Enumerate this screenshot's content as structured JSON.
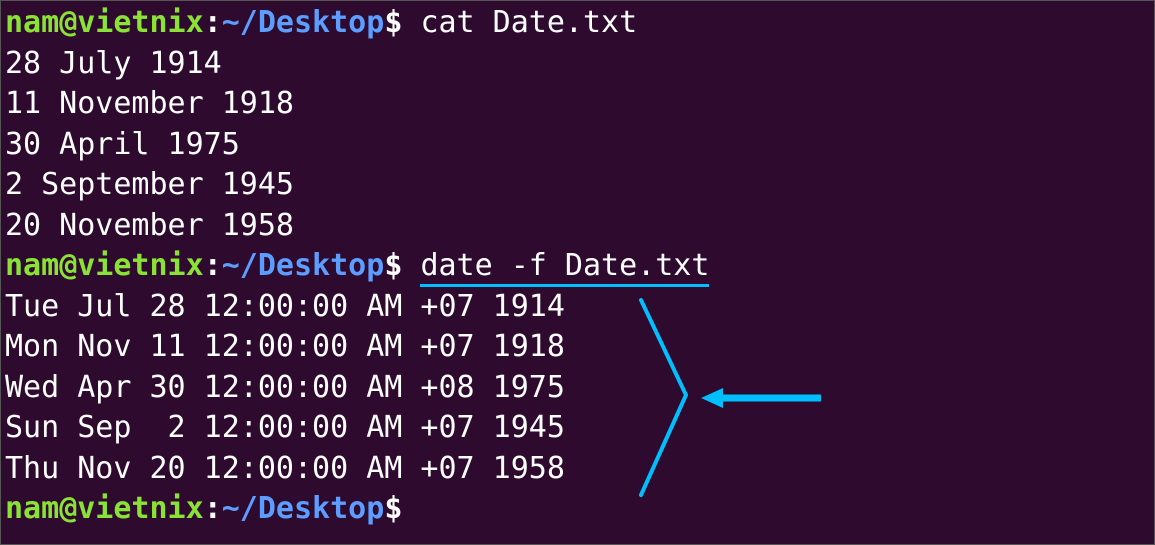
{
  "prompt": {
    "user": "nam",
    "at": "@",
    "host": "vietnix",
    "colon": ":",
    "path": "~/Desktop",
    "dollar": "$"
  },
  "commands": {
    "cat": "cat Date.txt",
    "date": "date -f Date.txt"
  },
  "catOutput": [
    "28 July 1914",
    "11 November 1918",
    "30 April 1975",
    "2 September 1945",
    "20 November 1958"
  ],
  "dateOutput": [
    "Tue Jul 28 12:00:00 AM +07 1914",
    "Mon Nov 11 12:00:00 AM +07 1918",
    "Wed Apr 30 12:00:00 AM +08 1975",
    "Sun Sep  2 12:00:00 AM +07 1945",
    "Thu Nov 20 12:00:00 AM +07 1958"
  ],
  "annotationColor": "#00bfff"
}
